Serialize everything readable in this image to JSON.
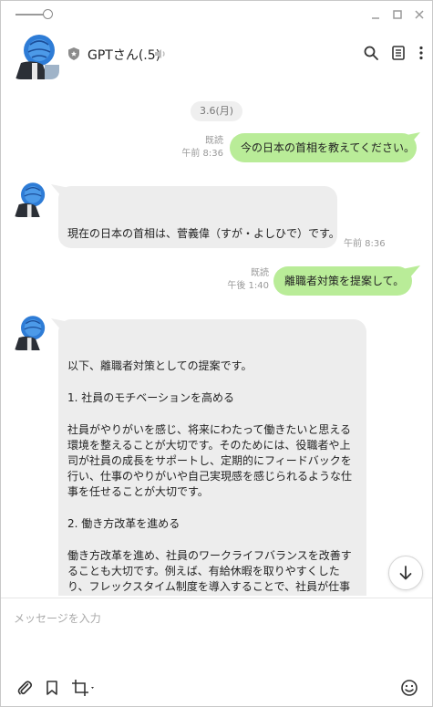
{
  "header": {
    "name": "GPTさん(.5)"
  },
  "date": "3.6(月)",
  "messages": [
    {
      "side": "out",
      "read": "既読",
      "time": "午前 8:36",
      "text": "今の日本の首相を教えてください。"
    },
    {
      "side": "in",
      "time": "午前 8:36",
      "text": "現在の日本の首相は、菅義偉（すが・よしひで）です。"
    },
    {
      "side": "out",
      "read": "既読",
      "time": "午後 1:40",
      "text": "離職者対策を提案して。"
    },
    {
      "side": "in",
      "paragraphs": [
        "以下、離職者対策としての提案です。",
        "1. 社員のモチベーションを高める",
        "社員がやりがいを感じ、将来にわたって働きたいと思える環境を整えることが大切です。そのためには、役職者や上司が社員の成長をサポートし、定期的にフィードバックを行い、仕事のやりがいや自己実現感を感じられるような仕事を任せることが大切です。",
        "2. 働き方改革を進める",
        "働き方改革を進め、社員のワークライフバランスを改善することも大切です。例えば、有給休暇を取りやすくしたり、フレックスタイム制度を導入することで、社員が仕事とプライベートの両方"
      ]
    }
  ],
  "input": {
    "placeholder": "メッセージを入力"
  },
  "colors": {
    "outgoing_bubble": "#b9ec98",
    "incoming_bubble": "#ededed"
  },
  "icons": {
    "title_controls": [
      "minimize-icon",
      "maximize-icon",
      "close-icon"
    ],
    "header": [
      "shield-icon",
      "speaker-icon",
      "search-icon",
      "menu-icon",
      "more-icon"
    ],
    "toolbar": [
      "attach-icon",
      "bookmark-icon",
      "crop-icon",
      "emoji-icon"
    ]
  }
}
